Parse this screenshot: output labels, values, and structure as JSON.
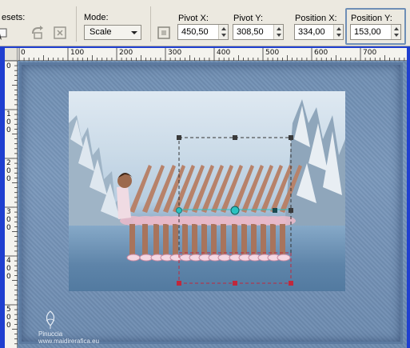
{
  "toolbar": {
    "presets_label": "esets:",
    "mode_label": "Mode:",
    "mode_value": "Scale",
    "pivot_x_label": "Pivot X:",
    "pivot_x_value": "450,50",
    "pivot_y_label": "Pivot Y:",
    "pivot_y_value": "308,50",
    "position_x_label": "Position X:",
    "position_x_value": "334,00",
    "position_y_label": "Position Y:",
    "position_y_value": "153,00"
  },
  "ruler": {
    "top_labels": [
      "0",
      "100",
      "200",
      "300",
      "400",
      "500",
      "600",
      "700"
    ],
    "left_labels": [
      "0",
      "1\n0\n0",
      "2\n0\n0",
      "3\n0\n0",
      "4\n0\n0",
      "5\n0\n0"
    ]
  },
  "watermark": {
    "line1": "Pinuccia",
    "line2": "www.maidirerafica.eu"
  },
  "colors": {
    "workspace_border": "#1f3fd0",
    "handle": "#c0283c",
    "selection_line": "#333333",
    "pivot": "#2ac2c0"
  }
}
